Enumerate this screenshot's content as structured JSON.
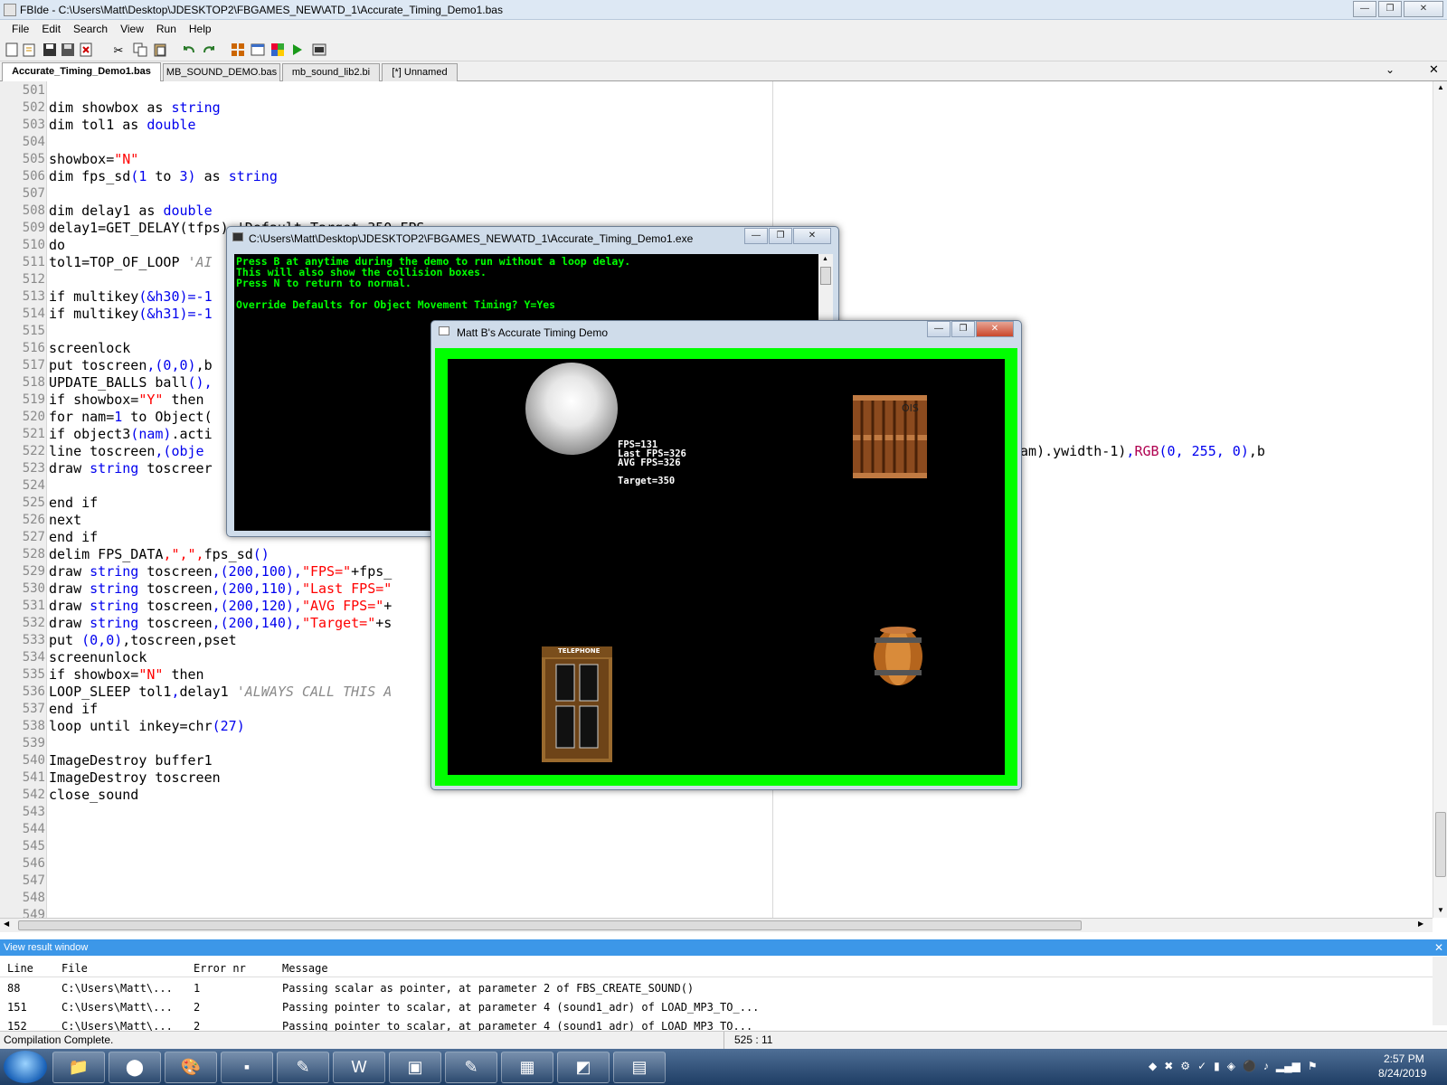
{
  "window": {
    "title": "FBIde - C:\\Users\\Matt\\Desktop\\JDESKTOP2\\FBGAMES_NEW\\ATD_1\\Accurate_Timing_Demo1.bas"
  },
  "menu": [
    "File",
    "Edit",
    "Search",
    "View",
    "Run",
    "Help"
  ],
  "tabs": [
    "Accurate_Timing_Demo1.bas",
    "MB_SOUND_DEMO.bas",
    "mb_sound_lib2.bi",
    "[*] Unnamed"
  ],
  "line_numbers": [
    "501",
    "502",
    "503",
    "504",
    "505",
    "506",
    "507",
    "508",
    "509",
    "510",
    "511",
    "512",
    "513",
    "514",
    "515",
    "516",
    "517",
    "518",
    "519",
    "520",
    "521",
    "522",
    "523",
    "524",
    "525",
    "526",
    "527",
    "528",
    "529",
    "530",
    "531",
    "532",
    "533",
    "534",
    "535",
    "536",
    "537",
    "538",
    "539",
    "540",
    "541",
    "542",
    "543",
    "544",
    "545",
    "546",
    "547",
    "548",
    "549"
  ],
  "code": {
    "l502": [
      "dim showbox as ",
      "string"
    ],
    "l503": [
      "dim tol1 as ",
      "double"
    ],
    "l505": [
      "showbox=",
      "\"N\""
    ],
    "l506": [
      "dim fps_sd",
      "(",
      "1",
      " to ",
      "3",
      ")",
      " as ",
      "string"
    ],
    "l508": [
      "dim delay1 as ",
      "double"
    ],
    "l509": "delay1=GET_DELAY(tfps) 'Default Target 350 FPS",
    "l510": "do",
    "l511": [
      "tol1=TOP_OF_LOOP ",
      "'AI"
    ],
    "l513": [
      "if multikey",
      "(&h30)=-1"
    ],
    "l514": [
      "if multikey",
      "(&h31)=-1"
    ],
    "l516": "screenlock",
    "l517": [
      "put toscreen",
      ",(0,0)",
      ",b"
    ],
    "l518": [
      "UPDATE_BALLS ball",
      "()",
      ","
    ],
    "l519": [
      "if showbox=",
      "\"Y\"",
      " then"
    ],
    "l520": [
      "for nam=",
      "1",
      " to Object("
    ],
    "l521": [
      "if object3",
      "(nam)",
      ".acti"
    ],
    "l522": [
      "line toscreen",
      ",(obje"
    ],
    "l522_right": [
      ").ywidth-1)",
      ",",
      "RGB",
      "(0, 255, 0)",
      ",b"
    ],
    "l522_right_prefix": "am",
    "l523": [
      "draw ",
      "string",
      " toscreer"
    ],
    "l525": "end if",
    "l526": "next",
    "l527": "end if",
    "l528": [
      "delim FPS_DATA",
      ",\",\",",
      "fps_sd",
      "()"
    ],
    "l529": [
      "draw ",
      "string",
      " toscreen",
      ",(200,100),",
      "\"FPS=\"",
      "+fps_"
    ],
    "l530": [
      "draw ",
      "string",
      " toscreen",
      ",(200,110),",
      "\"Last FPS=\""
    ],
    "l531": [
      "draw ",
      "string",
      " toscreen",
      ",(200,120),",
      "\"AVG FPS=\"",
      "+"
    ],
    "l532": [
      "draw ",
      "string",
      " toscreen",
      ",(200,140),",
      "\"Target=\"",
      "+s"
    ],
    "l533": [
      "put ",
      "(0,0)",
      ",toscreen",
      ",pset"
    ],
    "l534": "screenunlock",
    "l535": [
      "if showbox=",
      "\"N\"",
      " then"
    ],
    "l536": [
      "LOOP_SLEEP tol1",
      ",",
      "delay1 ",
      "'ALWAYS CALL THIS A"
    ],
    "l537": "end if",
    "l538": [
      "loop until inkey=chr",
      "(27)"
    ],
    "l540": "ImageDestroy buffer1",
    "l541": "ImageDestroy toscreen",
    "l542": "close_sound"
  },
  "console": {
    "title": "C:\\Users\\Matt\\Desktop\\JDESKTOP2\\FBGAMES_NEW\\ATD_1\\Accurate_Timing_Demo1.exe",
    "lines": [
      "Press B at anytime during the demo to run without a loop delay.",
      "This will also show the collision boxes.",
      "Press N to return to normal.",
      "",
      "Override Defaults for Object Movement Timing? Y=Yes"
    ]
  },
  "game": {
    "title": "Matt B's Accurate Timing Demo",
    "hud": [
      "FPS=131",
      "Last FPS=326",
      "AVG FPS=326",
      "",
      "Target=350"
    ],
    "booth_sign": "TELEPHONE",
    "crate_label": "OIS",
    "border_color": "#00ff00"
  },
  "results": {
    "title": "View result window",
    "headers": [
      "Line",
      "File",
      "Error nr",
      "Message"
    ],
    "rows": [
      [
        "88",
        "C:\\Users\\Matt\\...",
        "1",
        "Passing scalar as pointer, at parameter 2 of FBS_CREATE_SOUND()"
      ],
      [
        "151",
        "C:\\Users\\Matt\\...",
        "2",
        "Passing pointer to scalar, at parameter 4 (sound1_adr) of LOAD_MP3_TO_..."
      ],
      [
        "152",
        "C:\\Users\\Matt\\...",
        "2",
        "Passing pointer to scalar, at parameter 4 (sound1_adr) of LOAD_MP3_TO..."
      ]
    ]
  },
  "status": {
    "message": "Compilation Complete.",
    "position": "525 : 11"
  },
  "clock": {
    "time": "2:57 PM",
    "date": "8/24/2019"
  }
}
